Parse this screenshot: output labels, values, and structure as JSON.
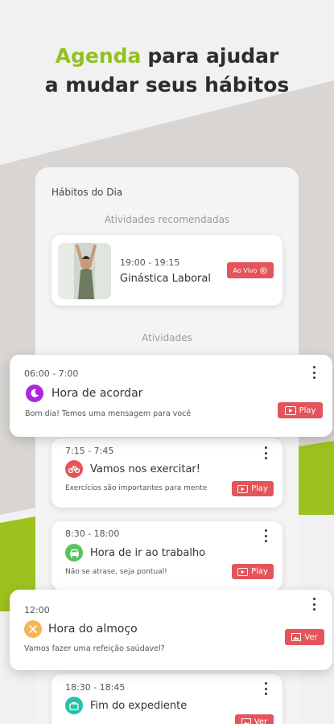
{
  "headline": {
    "accent": "Agenda",
    "line1_rest": "para ajudar",
    "line2": "a mudar  seus hábitos"
  },
  "colors": {
    "accent": "#92c01f",
    "play_button": "#e5545b",
    "wake": "#b026e0",
    "exercise": "#e5545b",
    "work": "#5ac35b",
    "lunch": "#f5b753",
    "end": "#26bfa8"
  },
  "screen": {
    "title": "Hábitos do Dia",
    "recommended_label": "Atividades recomendadas",
    "activities_label": "Atividades"
  },
  "recommended": {
    "time": "19:00 - 19:15",
    "title": "Ginástica Laboral",
    "button": "Ao Vivo"
  },
  "activities": [
    {
      "time": "06:00 - 7:00",
      "title": "Hora de acordar",
      "subtitle": "Bom dia! Temos uma mensagem para você",
      "button": "Play",
      "icon": "moon-icon"
    },
    {
      "time": "7:15 - 7:45",
      "title": "Vamos nos exercitar!",
      "subtitle": "Exercícios são importantes para mente",
      "button": "Play",
      "icon": "bicycle-icon"
    },
    {
      "time": "8:30 - 18:00",
      "title": "Hora de ir ao trabalho",
      "subtitle": "Não se atrase, seja pontual!",
      "button": "Play",
      "icon": "car-icon"
    },
    {
      "time": "12:00",
      "title": "Hora do almoço",
      "subtitle": "Vamos fazer uma refeição saúdavel?",
      "button": "Ver",
      "icon": "utensils-icon"
    },
    {
      "time": "18:30 - 18:45",
      "title": "Fim do expediente",
      "subtitle": "",
      "button": "Ver",
      "icon": "briefcase-icon"
    }
  ]
}
